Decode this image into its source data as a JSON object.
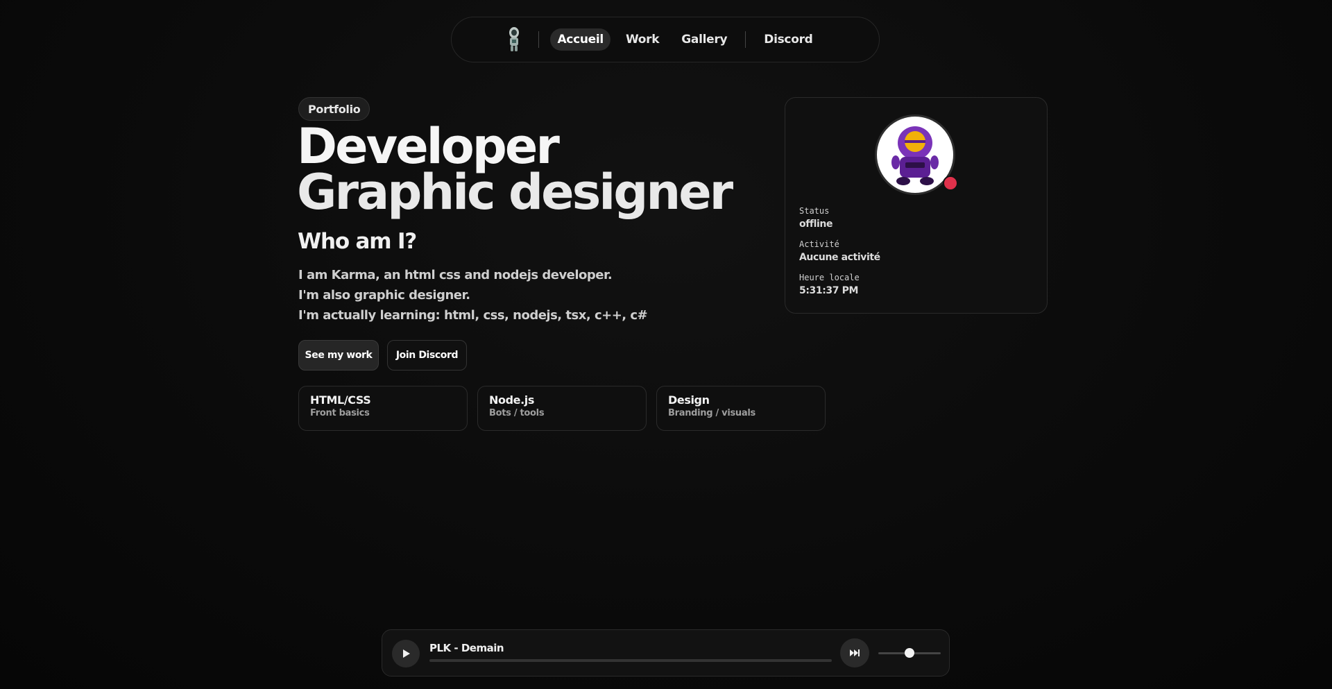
{
  "nav": {
    "links": [
      "Accueil",
      "Work",
      "Gallery",
      "Discord"
    ],
    "active_index": 0
  },
  "hero": {
    "badge": "Portfolio",
    "headline": [
      "Developer",
      "Graphic designer"
    ],
    "subhead": "Who am I?",
    "bio": [
      "I am Karma, an html css and nodejs developer.",
      "I'm also graphic designer.",
      "I'm actually learning: html, css, nodejs, tsx, c++, c#"
    ],
    "buttons": {
      "primary": "See my work",
      "secondary": "Join Discord"
    }
  },
  "skills": [
    {
      "title": "HTML/CSS",
      "subtitle": "Front basics"
    },
    {
      "title": "Node.js",
      "subtitle": "Bots / tools"
    },
    {
      "title": "Design",
      "subtitle": "Branding / visuals"
    }
  ],
  "profile": {
    "status_label": "Status",
    "status_value": "offline",
    "status_color": "#e0314b",
    "activity_label": "Activité",
    "activity_value": "Aucune activité",
    "time_label": "Heure locale",
    "time_value": "5:31:37 PM"
  },
  "player": {
    "track": "PLK - Demain",
    "progress": 0.0,
    "volume": 0.5
  },
  "icons": {
    "play": "play-icon",
    "skip": "skip-forward-icon",
    "logo": "astronaut-logo-icon",
    "avatar": "purple-plush-avatar"
  }
}
